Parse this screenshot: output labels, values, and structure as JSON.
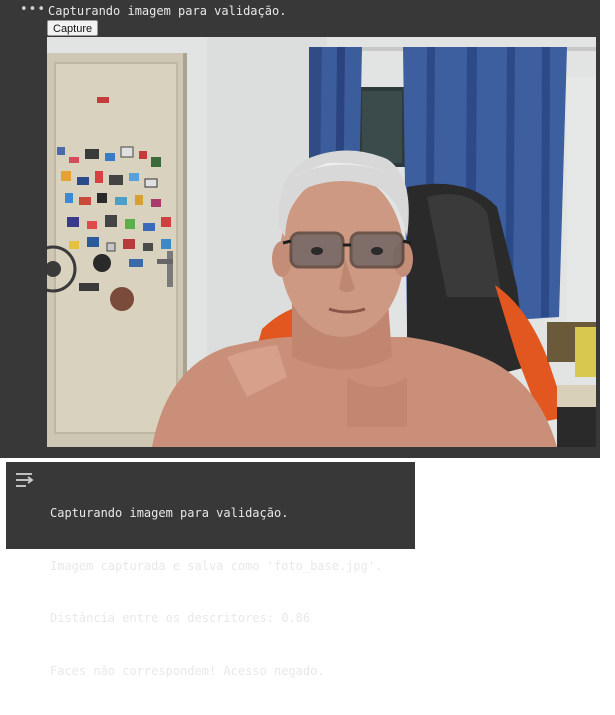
{
  "cell": {
    "menu_icon": "ellipsis-icon",
    "status_text": "Capturando imagem para validação.",
    "capture_button_label": "Capture",
    "video": {
      "description_icon": "webcam-video-feed"
    }
  },
  "output": {
    "icon": "output-toggle-icon",
    "lines": [
      "Capturando imagem para validação.",
      "Imagem capturada e salva como 'foto_base.jpg'.",
      "Distância entre os descritores: 0.86",
      "Faces não correspondem! Acesso negado."
    ]
  }
}
